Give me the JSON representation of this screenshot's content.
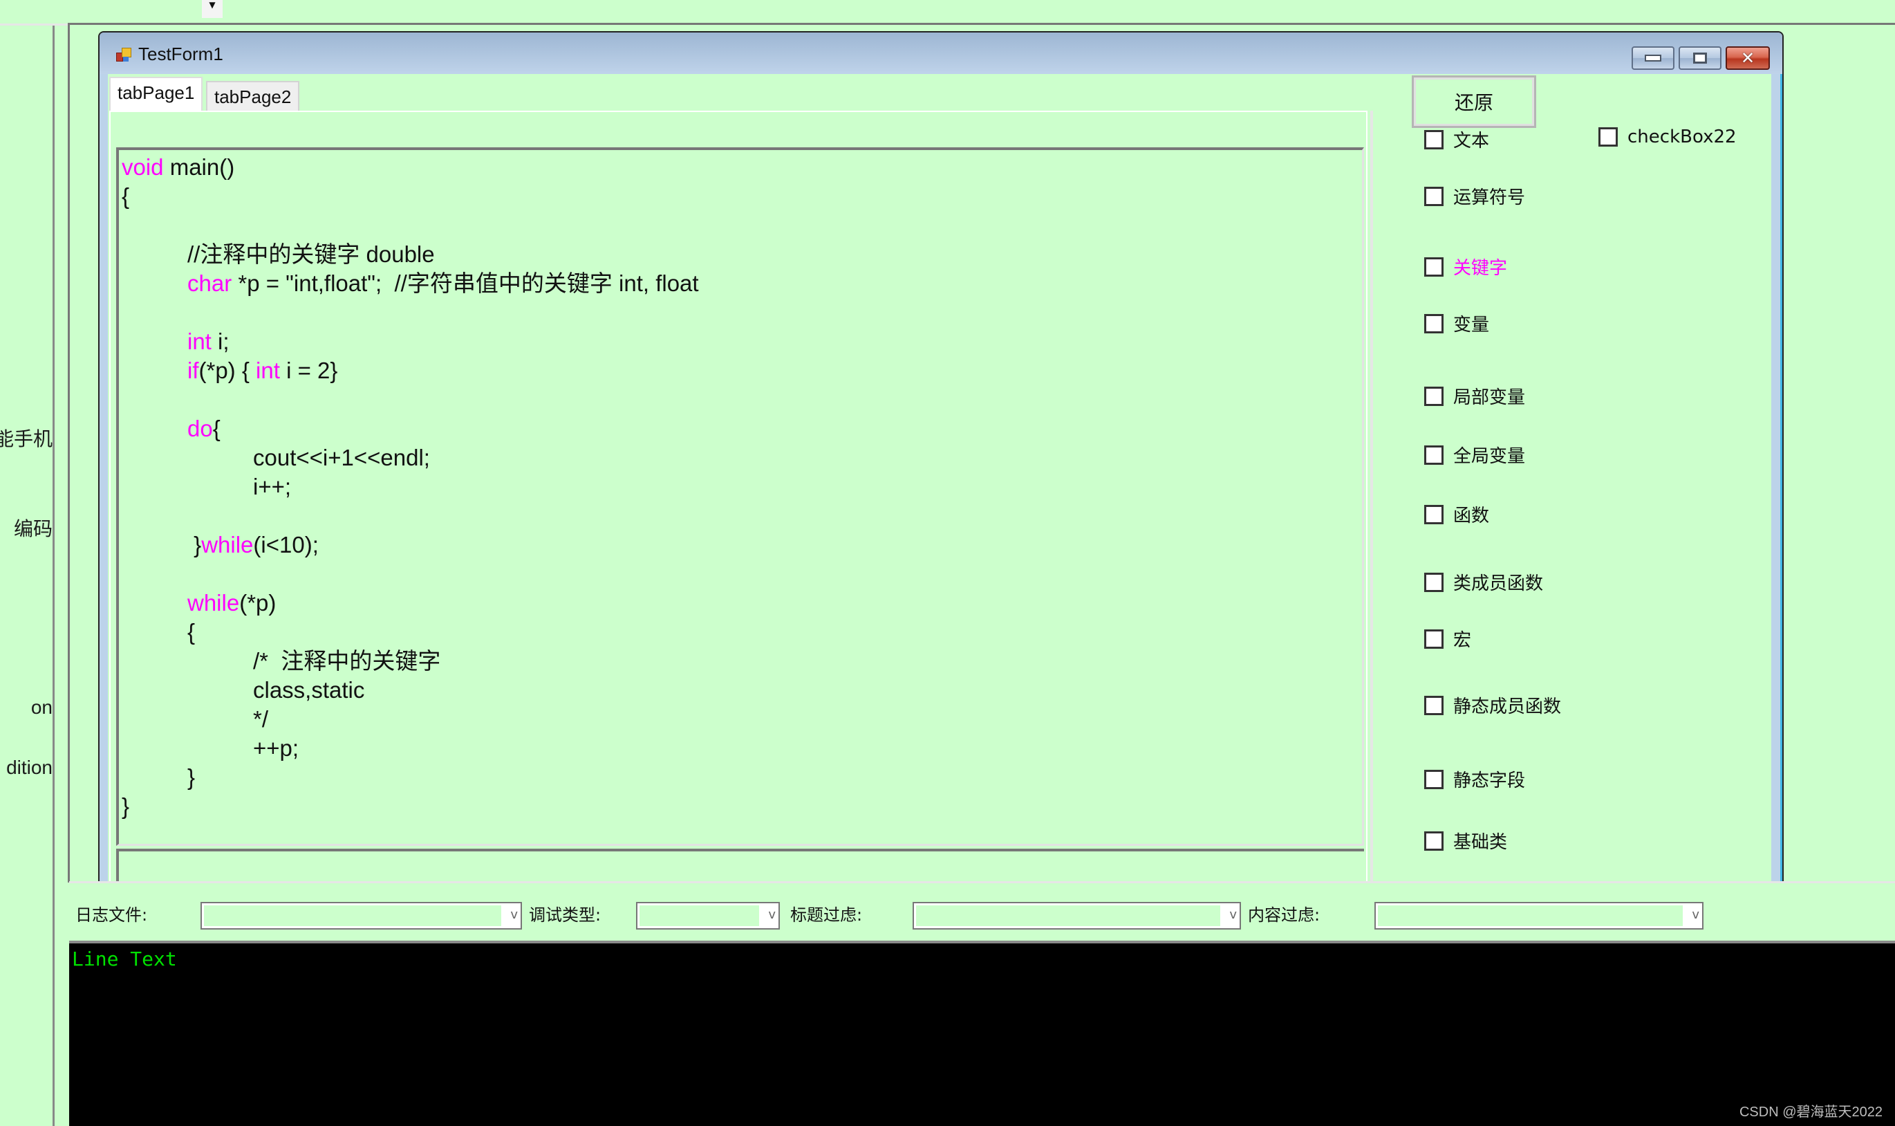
{
  "top_bar": {
    "dropdown_icon": "triangle-down"
  },
  "left_panel": {
    "items": [
      "智能手机",
      "编码",
      "on",
      "dition"
    ]
  },
  "window": {
    "title": "TestForm1",
    "controls": {
      "minimize": "minimize",
      "maximize": "maximize",
      "close": "close"
    }
  },
  "tabs": [
    {
      "label": "tabPage1",
      "active": true
    },
    {
      "label": "tabPage2",
      "active": false
    }
  ],
  "code": {
    "lines": [
      [
        {
          "t": "void",
          "kw": true
        },
        {
          "t": " main()"
        }
      ],
      [
        {
          "t": "{"
        }
      ],
      [],
      [
        {
          "t": "\t//注释中的关键字 double"
        }
      ],
      [
        {
          "t": "\t"
        },
        {
          "t": "char",
          "kw": true
        },
        {
          "t": " *p = \"int,float\";  //字符串值中的关键字 int, float"
        }
      ],
      [],
      [
        {
          "t": "\t"
        },
        {
          "t": "int",
          "kw": true
        },
        {
          "t": " i;"
        }
      ],
      [
        {
          "t": "\t"
        },
        {
          "t": "if",
          "kw": true
        },
        {
          "t": "(*p) { "
        },
        {
          "t": "int",
          "kw": true
        },
        {
          "t": " i = 2}"
        }
      ],
      [],
      [
        {
          "t": "\t"
        },
        {
          "t": "do",
          "kw": true
        },
        {
          "t": "{"
        }
      ],
      [
        {
          "t": "\t\tcout<<i+1<<endl;"
        }
      ],
      [
        {
          "t": "\t\ti++;"
        }
      ],
      [],
      [
        {
          "t": "\t }"
        },
        {
          "t": "while",
          "kw": true
        },
        {
          "t": "(i<10);"
        }
      ],
      [],
      [
        {
          "t": "\t"
        },
        {
          "t": "while",
          "kw": true
        },
        {
          "t": "(*p)"
        }
      ],
      [
        {
          "t": "\t{"
        }
      ],
      [
        {
          "t": "\t\t/*  注释中的关键字"
        }
      ],
      [
        {
          "t": "\t\tclass,static"
        }
      ],
      [
        {
          "t": "\t\t*/"
        }
      ],
      [
        {
          "t": "\t\t++p;"
        }
      ],
      [
        {
          "t": "\t}"
        }
      ],
      [
        {
          "t": "}"
        }
      ]
    ],
    "keyword_color": "#ff00ff"
  },
  "right_panel": {
    "restore_button": "还原",
    "checkboxes": [
      {
        "label": "文本",
        "checked": false
      },
      {
        "label": "checkBox22",
        "checked": false
      },
      {
        "label": "运算符号",
        "checked": false
      },
      {
        "label": "关键字",
        "checked": false,
        "color": "#ff00ff"
      },
      {
        "label": " 变量",
        "checked": false
      },
      {
        "label": "局部变量",
        "checked": false
      },
      {
        "label": "全局变量",
        "checked": false
      },
      {
        "label": "函数",
        "checked": false
      },
      {
        "label": "类成员函数",
        "checked": false
      },
      {
        "label": "宏",
        "checked": false
      },
      {
        "label": "静态成员函数",
        "checked": false
      },
      {
        "label": "静态字段",
        "checked": false
      },
      {
        "label": "基础类",
        "checked": false
      }
    ]
  },
  "filter_bar": {
    "log_file_label": "日志文件:",
    "log_file_value": "",
    "debug_type_label": "调试类型:",
    "debug_type_value": "",
    "title_filter_label": "标题过虑:",
    "title_filter_value": "",
    "content_filter_label": "内容过虑:",
    "content_filter_value": "",
    "arrow": "v"
  },
  "console": {
    "text": "Line Text",
    "text_color": "#00e000"
  },
  "watermark": "CSDN @碧海蓝天2022"
}
